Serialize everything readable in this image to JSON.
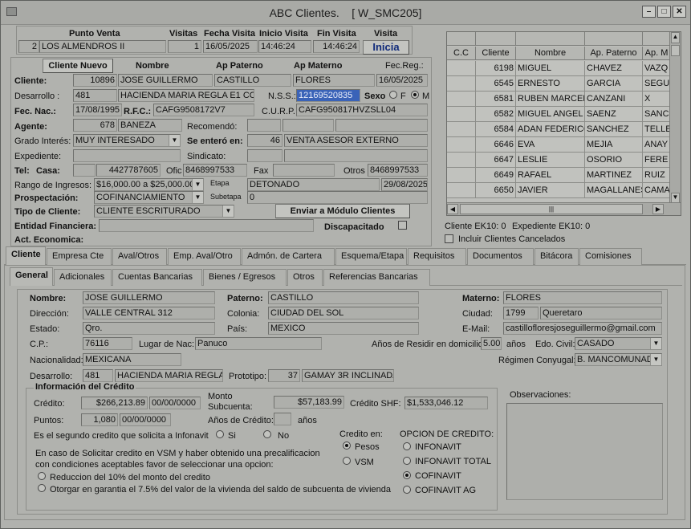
{
  "window": {
    "title": "ABC Clientes.",
    "window_id": "[ W_SMC205]"
  },
  "visit": {
    "headers": [
      "Punto Venta",
      "Visitas",
      "Fecha Visita",
      "Inicio Visita",
      "Fin Visita",
      "Visita"
    ],
    "punto_num": "2",
    "punto_name": "LOS ALMENDROS II",
    "visitas": "1",
    "fecha": "16/05/2025",
    "inicio": "14:46:24",
    "fin": "14:46:24",
    "inicia_label": "Inicia"
  },
  "cliente": {
    "nuevo_label": "Cliente Nuevo",
    "col_nombre": "Nombre",
    "col_paterno": "Ap Paterno",
    "col_materno": "Ap Materno",
    "col_fec_reg": "Fec.Reg.:",
    "cliente_label": "Cliente:",
    "id": "10896",
    "nombre": "JOSE GUILLERMO",
    "paterno": "CASTILLO",
    "materno": "FLORES",
    "fec_reg": "16/05/2025",
    "desarrollo_label": "Desarrollo :",
    "desarrollo_num": "481",
    "desarrollo_name": "HACIENDA MARIA REGLA E1 COME",
    "nss_label": "N.S.S.:",
    "nss": "12169520835",
    "sexo_label": "Sexo",
    "sexo_f": "F",
    "sexo_m": "M",
    "fec_nac_label": "Fec. Nac.:",
    "fec_nac": "17/08/1995",
    "rfc_label": "R.F.C.:",
    "rfc": "CAFG9508172V7",
    "curp_label": "C.U.R.P.:",
    "curp": "CAFG950817HVZSLL04",
    "agente_label": "Agente:",
    "agente_num": "678",
    "agente_name": "BANEZA",
    "recomendo_label": "Recomendó:",
    "grado_label": "Grado Interés:",
    "grado": "MUY INTERESADO",
    "se_entero_label": "Se enteró en:",
    "se_entero_num": "46",
    "se_entero": "VENTA ASESOR EXTERNO",
    "expediente_label": "Expediente:",
    "sindicato_label": "Sindicato:",
    "tel_label": "Tel:",
    "casa_label": "Casa:",
    "casa": "4427787605",
    "ofic_label": "Ofic",
    "ofic": "8468997533",
    "fax_label": "Fax",
    "otros_label": "Otros",
    "otros": "8468997533",
    "rango_label": "Rango de Ingresos:",
    "rango": "$16,000.00 a $25,000.00",
    "etapa_label": "Etapa",
    "etapa": "DETONADO",
    "etapa_fecha": "29/08/2025",
    "prospectacion_label": "Prospectación:",
    "prospectacion": "COFINANCIAMIENTO",
    "subetapa_label": "Subetapa",
    "subetapa": "0",
    "tipo_label": "Tipo de Cliente:",
    "tipo": "CLIENTE  ESCRITURADO",
    "enviar_label": "Enviar a Módulo Clientes",
    "entidad_label": "Entidad Financiera:",
    "discapacitado_label": "Discapacitado",
    "act_label": "Act. Economica:"
  },
  "grid": {
    "headers": [
      "C.C",
      "Cliente",
      "Nombre",
      "Ap. Paterno",
      "Ap. M"
    ],
    "rows": [
      [
        "",
        "6198",
        "MIGUEL",
        "CHAVEZ",
        "VAZQ"
      ],
      [
        "",
        "6545",
        "ERNESTO",
        "GARCIA",
        "SEGU"
      ],
      [
        "",
        "6581",
        "RUBEN MARCELO",
        "CANZANI",
        "X"
      ],
      [
        "",
        "6582",
        "MIGUEL ANGEL",
        "SAENZ",
        "SANC"
      ],
      [
        "",
        "6584",
        "ADAN FEDERICO",
        "SANCHEZ",
        "TELLE"
      ],
      [
        "",
        "6646",
        "EVA",
        "MEJIA",
        "ANAY"
      ],
      [
        "",
        "6647",
        "LESLIE",
        "OSORIO",
        "FERE"
      ],
      [
        "",
        "6649",
        "RAFAEL",
        "MARTINEZ",
        "RUIZ"
      ],
      [
        "",
        "6650",
        "JAVIER",
        "MAGALLANES",
        "CAMA"
      ]
    ],
    "ek10": "Cliente EK10: 0",
    "exp_ek10": "Expediente EK10: 0",
    "incluir_label": "Incluir Clientes Cancelados"
  },
  "tabs1": [
    "Cliente",
    "Empresa Cte",
    "Aval/Otros",
    "Emp. Aval/Otro",
    "Admón. de Cartera",
    "Esquema/Etapa",
    "Requisitos",
    "Documentos",
    "Bitácora",
    "Comisiones"
  ],
  "tabs2": [
    "General",
    "Adicionales",
    "Cuentas Bancarias",
    "Bienes / Egresos",
    "Otros",
    "Referencias Bancarias"
  ],
  "general": {
    "nombre_label": "Nombre:",
    "nombre": "JOSE GUILLERMO",
    "paterno_label": "Paterno:",
    "paterno": "CASTILLO",
    "materno_label": "Materno:",
    "materno": "FLORES",
    "direccion_label": "Dirección:",
    "direccion": "VALLE CENTRAL 312",
    "colonia_label": "Colonia:",
    "colonia": "CIUDAD DEL SOL",
    "ciudad_label": "Ciudad:",
    "ciudad_num": "1799",
    "ciudad": "Queretaro",
    "estado_label": "Estado:",
    "estado": "Qro.",
    "pais_label": "País:",
    "pais": "MEXICO",
    "email_label": "E-Mail:",
    "email": "castillofloresjoseguillermo@gmail.com",
    "cp_label": "C.P.:",
    "cp": "76116",
    "lugar_label": "Lugar de Nac:",
    "lugar": "Panuco",
    "anios_residir_label": "Años de Residir en domicilio:",
    "anios_residir": "5.00",
    "anios_unit": "años",
    "civil_label": "Edo. Civil:",
    "civil": "CASADO",
    "nacionalidad_label": "Nacionalidad:",
    "nacionalidad": "MEXICANA",
    "regimen_label": "Régimen Conyugal:",
    "regimen": "B. MANCOMUNAD",
    "desarrollo_label": "Desarrollo:",
    "desarrollo_num": "481",
    "desarrollo_name": "HACIENDA MARIA REGLA E",
    "prototipo_label": "Prototipo:",
    "prototipo_num": "37",
    "prototipo": "GAMAY 3R INCLINADA"
  },
  "credito": {
    "section_label": "Información del Crédito",
    "credito_label": "Crédito:",
    "credito": "$266,213.89",
    "credito_fecha": "00/00/0000",
    "monto_label_1": "Monto",
    "monto_label_2": "Subcuenta:",
    "monto": "$57,183.99",
    "shf_label": "Crédito SHF:",
    "shf": "$1,533,046.12",
    "puntos_label": "Puntos:",
    "puntos": "1,080",
    "puntos_fecha": "00/00/0000",
    "anios_credito_label": "Años de Crédito:",
    "anios_unit": "años",
    "segundo_label": "Es el segundo credito que solicita a Infonavit",
    "si": "Si",
    "no": "No",
    "credito_en_label": "Credito en:",
    "pesos": "Pesos",
    "vsm": "VSM",
    "opcion_label": "OPCION DE CREDITO:",
    "op1": "INFONAVIT",
    "op2": "INFONAVIT TOTAL",
    "op3": "COFINAVIT",
    "op4": "COFINAVIT AG",
    "vsm_text_1": "En caso de Solicitar credito en VSM y haber obtenido una precalificacion",
    "vsm_text_2": "con condiciones aceptables favor de seleccionar una opcion:",
    "reduccion": "Reduccion del 10% del monto del credito",
    "garantia": "Otorgar en garantia el 7.5% del valor de la vivienda del saldo de subcuenta de vivienda",
    "observaciones_label": "Observaciones:"
  }
}
